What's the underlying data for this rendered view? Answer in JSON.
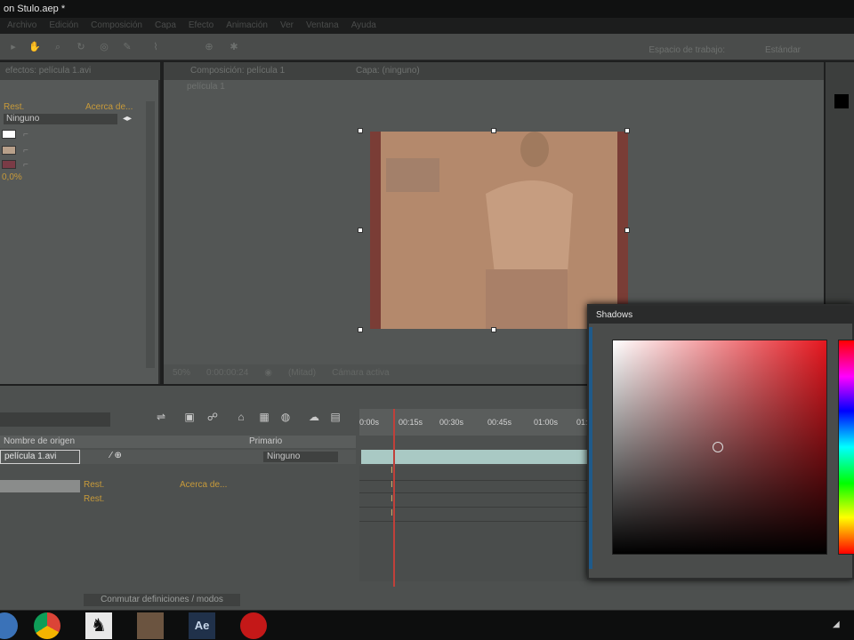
{
  "window": {
    "title": "on Stulo.aep *"
  },
  "menu": [
    "Archivo",
    "Edición",
    "Composición",
    "Capa",
    "Efecto",
    "Animación",
    "Ver",
    "Ventana",
    "Ayuda"
  ],
  "toolbar": {
    "workspace_label": "Espacio de trabajo:",
    "workspace_value": "Estándar"
  },
  "effects_panel": {
    "tab": "efectos: película 1.avi",
    "reset_label": "Rest.",
    "about_label": "Acerca de...",
    "preset_value": "Ninguno",
    "percent_value": "0,0%",
    "swatch_colors": [
      "#ffffff",
      "#b8a08a",
      "#7a3b46"
    ]
  },
  "viewer": {
    "tab_comp": "Composición: película 1",
    "tab_layer": "Capa: (ninguno)",
    "path": "película 1",
    "zoom": "50%",
    "timecode": "0:00:00:24",
    "resolution": "(Mitad)",
    "camera": "Cámara activa"
  },
  "timeline": {
    "col_source": "Nombre de origen",
    "col_parent": "Primario",
    "layer_name": "película 1.avi",
    "layer_parent": "Ninguno",
    "reset1": "Rest.",
    "about1": "Acerca de...",
    "reset2": "Rest.",
    "ticks": [
      "0:00s",
      "00:15s",
      "00:30s",
      "00:45s",
      "01:00s",
      "01:"
    ],
    "switch_modes": "Conmutar definiciones / modos",
    "playhead_color": "#c0403a"
  },
  "picker": {
    "title": "Shadows"
  },
  "taskbar": {
    "apps": [
      "start-button",
      "chrome-icon",
      "counter-strike-icon",
      "photo-thumbnail-icon",
      "after-effects-icon",
      "record-icon"
    ]
  }
}
